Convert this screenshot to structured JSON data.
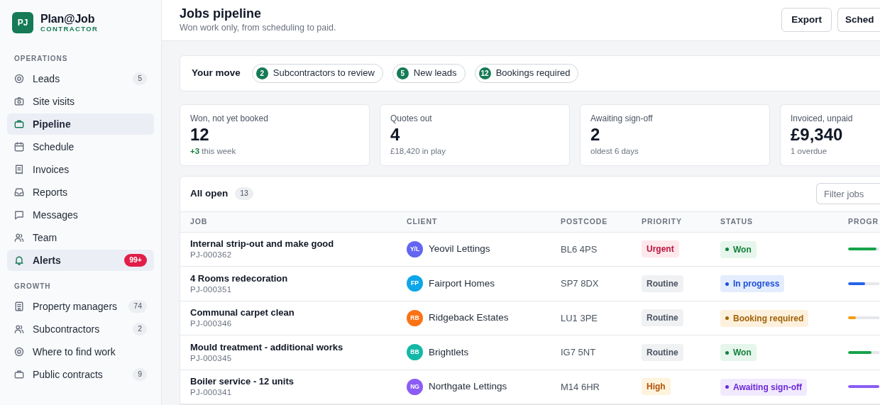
{
  "brand": {
    "logo": "PJ",
    "name": "Plan@Job",
    "tagline": "CONTRACTOR"
  },
  "sidebar": {
    "sections": [
      {
        "title": "OPERATIONS",
        "items": [
          {
            "label": "Leads",
            "selected": false,
            "badge": {
              "text": "5",
              "urgent": false
            }
          },
          {
            "label": "Site visits",
            "selected": false
          },
          {
            "label": "Pipeline",
            "selected": true
          },
          {
            "label": "Schedule",
            "selected": false
          },
          {
            "label": "Invoices",
            "selected": false
          },
          {
            "label": "Reports",
            "selected": false
          },
          {
            "label": "Messages",
            "selected": false
          },
          {
            "label": "Team",
            "selected": false
          },
          {
            "label": "Alerts",
            "selected": true,
            "badge": {
              "text": "99+",
              "urgent": true
            }
          }
        ]
      },
      {
        "title": "GROWTH",
        "items": [
          {
            "label": "Property managers",
            "selected": false,
            "badge": {
              "text": "74",
              "urgent": false
            }
          },
          {
            "label": "Subcontractors",
            "selected": false,
            "badge": {
              "text": "2",
              "urgent": false
            }
          },
          {
            "label": "Where to find work",
            "selected": false
          },
          {
            "label": "Public contracts",
            "selected": false,
            "badge": {
              "text": "9",
              "urgent": false
            }
          }
        ]
      }
    ]
  },
  "header": {
    "title": "Jobs pipeline",
    "subtitle": "Won work only, from scheduling to paid.",
    "buttons": [
      "Export",
      "Sched"
    ]
  },
  "your_move": {
    "label": "Your move",
    "chips": [
      {
        "count": "2",
        "label": "Subcontractors to review"
      },
      {
        "count": "5",
        "label": "New leads"
      },
      {
        "count": "12",
        "label": "Bookings required"
      }
    ]
  },
  "stats": [
    {
      "label": "Won, not yet booked",
      "value": "12",
      "delta": "+3",
      "note": "this week"
    },
    {
      "label": "Quotes out",
      "value": "4",
      "note": "£18,420 in play"
    },
    {
      "label": "Awaiting sign-off",
      "value": "2",
      "note": "oldest 6 days"
    },
    {
      "label": "Invoiced, unpaid",
      "value": "£9,340",
      "note": "1 overdue"
    }
  ],
  "table": {
    "title": "All open",
    "count": "13",
    "filter": {
      "placeholder": "Filter jobs"
    },
    "columns": [
      "JOB",
      "CLIENT",
      "POSTCODE",
      "PRIORITY",
      "STATUS",
      "PROGR"
    ],
    "rows": [
      {
        "job": "Internal strip-out and make good",
        "ref": "PJ-000362",
        "initials": "Y/L",
        "color": "#6366f1",
        "client": "Yeovil Lettings",
        "postcode": "BL6 4PS",
        "priority": {
          "kind": "urgent",
          "text": "Urgent"
        },
        "status": {
          "kind": "won",
          "text": "Won"
        },
        "level": 0.9
      },
      {
        "job": "4 Rooms redecoration",
        "ref": "PJ-000351",
        "initials": "FP",
        "color": "#0ea5e9",
        "client": "Fairport Homes",
        "postcode": "SP7 8DX",
        "priority": {
          "kind": "routine",
          "text": "Routine"
        },
        "status": {
          "kind": "progress",
          "text": "In progress"
        },
        "level": 0.55
      },
      {
        "job": "Communal carpet clean",
        "ref": "PJ-000346",
        "initials": "RB",
        "color": "#f97316",
        "client": "Ridgeback Estates",
        "postcode": "LU1 3PE",
        "priority": {
          "kind": "routine",
          "text": "Routine"
        },
        "status": {
          "kind": "booking",
          "text": "Booking required"
        },
        "level": 0.25
      },
      {
        "job": "Mould treatment - additional works",
        "ref": "PJ-000345",
        "initials": "BB",
        "color": "#14b8a6",
        "client": "Brightlets",
        "postcode": "IG7 5NT",
        "priority": {
          "kind": "routine",
          "text": "Routine"
        },
        "status": {
          "kind": "won",
          "text": "Won"
        },
        "level": 0.75
      },
      {
        "job": "Boiler service - 12 units",
        "ref": "PJ-000341",
        "initials": "NG",
        "color": "#8b5cf6",
        "client": "Northgate Lettings",
        "postcode": "M14 6HR",
        "priority": {
          "kind": "high",
          "text": "High"
        },
        "status": {
          "kind": "awaiting",
          "text": "Awaiting sign-off"
        },
        "level": 1.0
      }
    ]
  }
}
